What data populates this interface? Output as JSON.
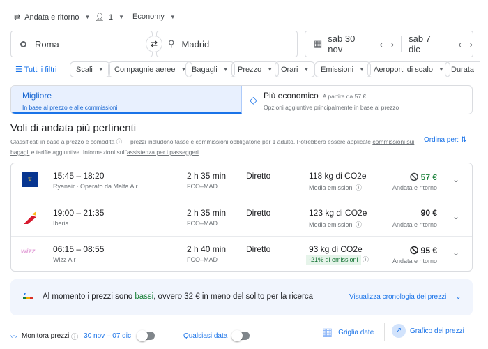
{
  "search": {
    "trip_type": "Andata e ritorno",
    "passengers": "1",
    "cabin": "Economy",
    "origin": "Roma",
    "destination": "Madrid",
    "depart_date": "sab 30 nov",
    "return_date": "sab 7 dic"
  },
  "filters": {
    "all": "Tutti i filtri",
    "chips": [
      "Scali",
      "Compagnie aeree",
      "Bagagli",
      "Prezzo",
      "Orari",
      "Emissioni",
      "Aeroporti di scalo",
      "Durata"
    ]
  },
  "tabs": {
    "best": {
      "label": "Migliore",
      "sub": "In base al prezzo e alle commissioni"
    },
    "cheapest": {
      "label": "Più economico",
      "from": "A partire da 57 €",
      "sub": "Opzioni aggiuntive principalmente in base al prezzo"
    }
  },
  "results": {
    "title": "Voli di andata più pertinenti",
    "desc1": "Classificati in base a prezzo e comodità",
    "desc2": "I prezzi includono tasse e commissioni obbligatorie per 1 adulto. Potrebbero essere applicate",
    "link1a": "commissioni sui",
    "link1b": "bagagli",
    "desc3": "e tariffe aggiuntive. Informazioni sull'",
    "link2": "assistenza per i passeggeri",
    "desc4": ".",
    "sort": "Ordina per:"
  },
  "flights": [
    {
      "times": "15:45 – 18:20",
      "airline": "Ryanair · Operato da Malta Air",
      "duration": "2 h 35 min",
      "route": "FCO–MAD",
      "stops": "Diretto",
      "co2": "118 kg di CO2e",
      "emissions": "Media emissioni",
      "price": "57 €",
      "price_note": "Andata e ritorno"
    },
    {
      "times": "19:00 – 21:35",
      "airline": "Iberia",
      "duration": "2 h 35 min",
      "route": "FCO–MAD",
      "stops": "Diretto",
      "co2": "123 kg di CO2e",
      "emissions": "Media emissioni",
      "price": "90 €",
      "price_note": "Andata e ritorno"
    },
    {
      "times": "06:15 – 08:55",
      "airline": "Wizz Air",
      "duration": "2 h 40 min",
      "route": "FCO–MAD",
      "stops": "Diretto",
      "co2": "93 kg di CO2e",
      "emissions": "-21% di emissioni",
      "price": "95 €",
      "price_note": "Andata e ritorno"
    }
  ],
  "insight": {
    "pre": "Al momento i prezzi sono ",
    "level": "bassi",
    "post": ", ovvero 32 € in meno del solito per la ricerca",
    "link": "Visualizza cronologia dei prezzi"
  },
  "bottom": {
    "track": "Monitora prezzi",
    "range": "30 nov – 07 dic",
    "any": "Qualsiasi data",
    "grid": "Griglia date",
    "graph": "Grafico dei prezzi"
  },
  "colors": {
    "accent": "#1a73e8",
    "green": "#188038"
  }
}
